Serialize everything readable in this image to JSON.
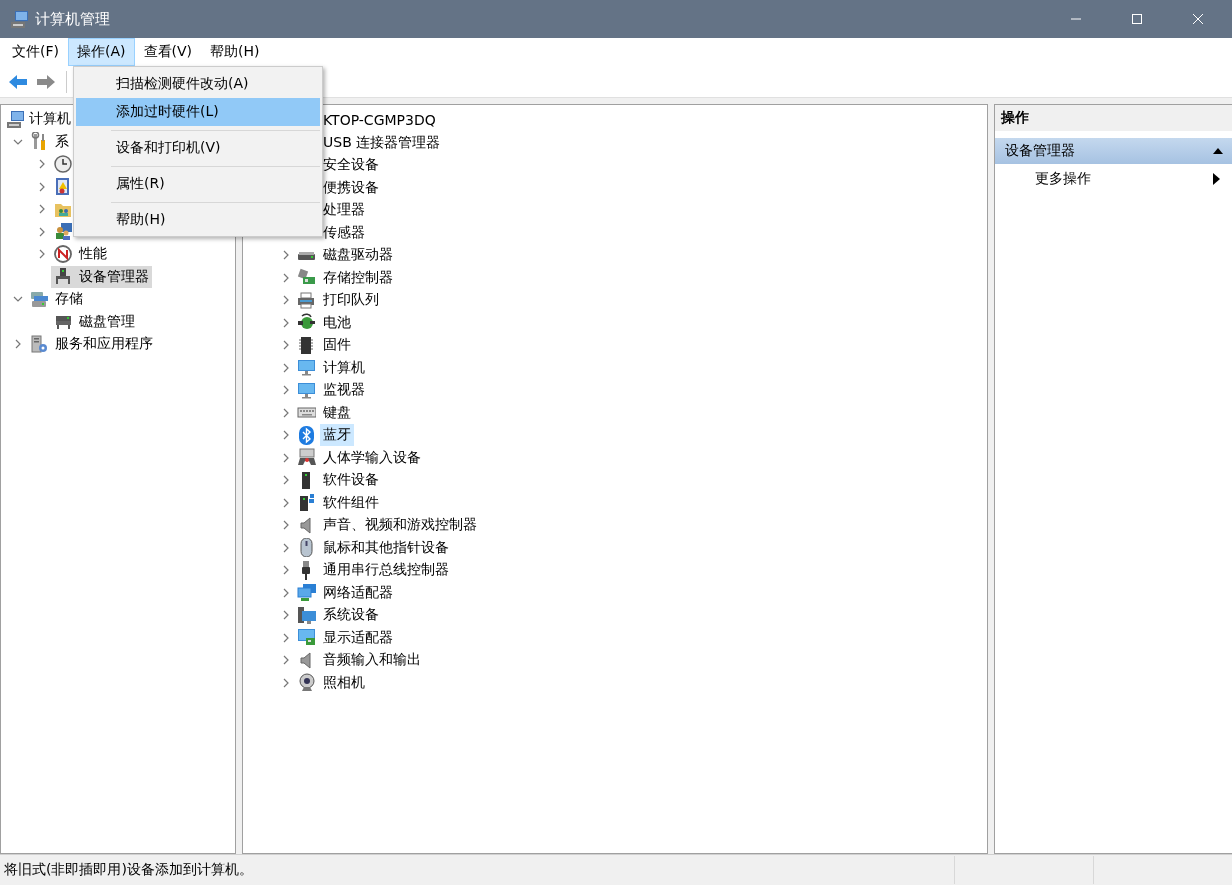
{
  "window": {
    "title": "计算机管理"
  },
  "menu_bar": [
    {
      "label": "文件(F)",
      "selected": false
    },
    {
      "label": "操作(A)",
      "selected": true
    },
    {
      "label": "查看(V)",
      "selected": false
    },
    {
      "label": "帮助(H)",
      "selected": false
    }
  ],
  "open_menu": {
    "items": [
      {
        "kind": "item",
        "label": "扫描检测硬件改动(A)",
        "selected": false
      },
      {
        "kind": "item",
        "label": "添加过时硬件(L)",
        "selected": true
      },
      {
        "kind": "separator"
      },
      {
        "kind": "item",
        "label": "设备和打印机(V)",
        "selected": false
      },
      {
        "kind": "separator"
      },
      {
        "kind": "item",
        "label": "属性(R)",
        "selected": false
      },
      {
        "kind": "separator"
      },
      {
        "kind": "item",
        "label": "帮助(H)",
        "selected": false
      }
    ]
  },
  "tree": [
    {
      "label": "计算机",
      "selected": false,
      "children": [
        {
          "label": "系",
          "expanded": true,
          "selected": false,
          "children": [
            {
              "expanded": false,
              "selected": false
            },
            {
              "expanded": false,
              "selected": false
            },
            {
              "expanded": false,
              "selected": false
            },
            {
              "expanded": false,
              "selected": false
            },
            {
              "label": "性能",
              "expanded": false,
              "selected": false
            },
            {
              "label": "设备管理器",
              "selected": true
            }
          ]
        },
        {
          "label": "存储",
          "expanded": true,
          "selected": false,
          "children": [
            {
              "label": "磁盘管理",
              "selected": false
            }
          ]
        },
        {
          "label": "服务和应用程序",
          "expanded": false,
          "selected": false
        }
      ]
    }
  ],
  "devices": {
    "root": "KTOP-CGMP3DQ",
    "items": [
      {
        "label": "USB 连接器管理器",
        "selected": false
      },
      {
        "label": "安全设备",
        "selected": false
      },
      {
        "label": "便携设备",
        "selected": false
      },
      {
        "label": "处理器",
        "selected": false
      },
      {
        "label": "传感器",
        "selected": false
      },
      {
        "label": "磁盘驱动器",
        "selected": false
      },
      {
        "label": "存储控制器",
        "selected": false
      },
      {
        "label": "打印队列",
        "selected": false
      },
      {
        "label": "电池",
        "selected": false
      },
      {
        "label": "固件",
        "selected": false
      },
      {
        "label": "计算机",
        "selected": false
      },
      {
        "label": "监视器",
        "selected": false
      },
      {
        "label": "键盘",
        "selected": false
      },
      {
        "label": "蓝牙",
        "selected": true
      },
      {
        "label": "人体学输入设备",
        "selected": false
      },
      {
        "label": "软件设备",
        "selected": false
      },
      {
        "label": "软件组件",
        "selected": false
      },
      {
        "label": "声音、视频和游戏控制器",
        "selected": false
      },
      {
        "label": "鼠标和其他指针设备",
        "selected": false
      },
      {
        "label": "通用串行总线控制器",
        "selected": false
      },
      {
        "label": "网络适配器",
        "selected": false
      },
      {
        "label": "系统设备",
        "selected": false
      },
      {
        "label": "显示适配器",
        "selected": false
      },
      {
        "label": "音频输入和输出",
        "selected": false
      },
      {
        "label": "照相机",
        "selected": false
      }
    ]
  },
  "actions": {
    "title": "操作",
    "sections": [
      {
        "label": "设备管理器",
        "expanded": true,
        "items": [
          {
            "label": "更多操作"
          }
        ]
      }
    ]
  },
  "status_bar": {
    "text": "将旧式(非即插即用)设备添加到计算机。"
  }
}
